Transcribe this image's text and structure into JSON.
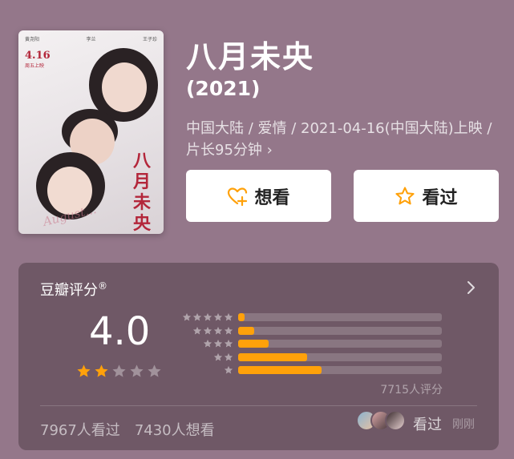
{
  "poster": {
    "title_text": "八月未央",
    "release_text": "4.16",
    "release_sub": "周五上映",
    "script_text": "August...",
    "credit_names": [
      "黄尧阳",
      "李兰",
      "王子珍"
    ]
  },
  "movie": {
    "title": "八月未央",
    "year": "(2021)",
    "meta": "中国大陆 / 爱情 / 2021-04-16(中国大陆)上映 / 片长95分钟 ›"
  },
  "actions": {
    "want_label": "想看",
    "seen_label": "看过"
  },
  "rating": {
    "label": "豆瓣评分",
    "mark": "®",
    "score": "4.0",
    "stars_filled": 2,
    "stars_total": 5,
    "distribution": [
      {
        "stars": 5,
        "fraction": 0.03
      },
      {
        "stars": 4,
        "fraction": 0.08
      },
      {
        "stars": 3,
        "fraction": 0.15
      },
      {
        "stars": 2,
        "fraction": 0.34
      },
      {
        "stars": 1,
        "fraction": 0.41
      }
    ],
    "rating_count": "7715人评分",
    "watched": "7967人看过",
    "wanted": "7430人想看",
    "friends_seen": "看过",
    "friends_time": "刚刚"
  },
  "colors": {
    "background": "#94778a",
    "card": "#6f5866",
    "accent": "#ffa10a"
  }
}
